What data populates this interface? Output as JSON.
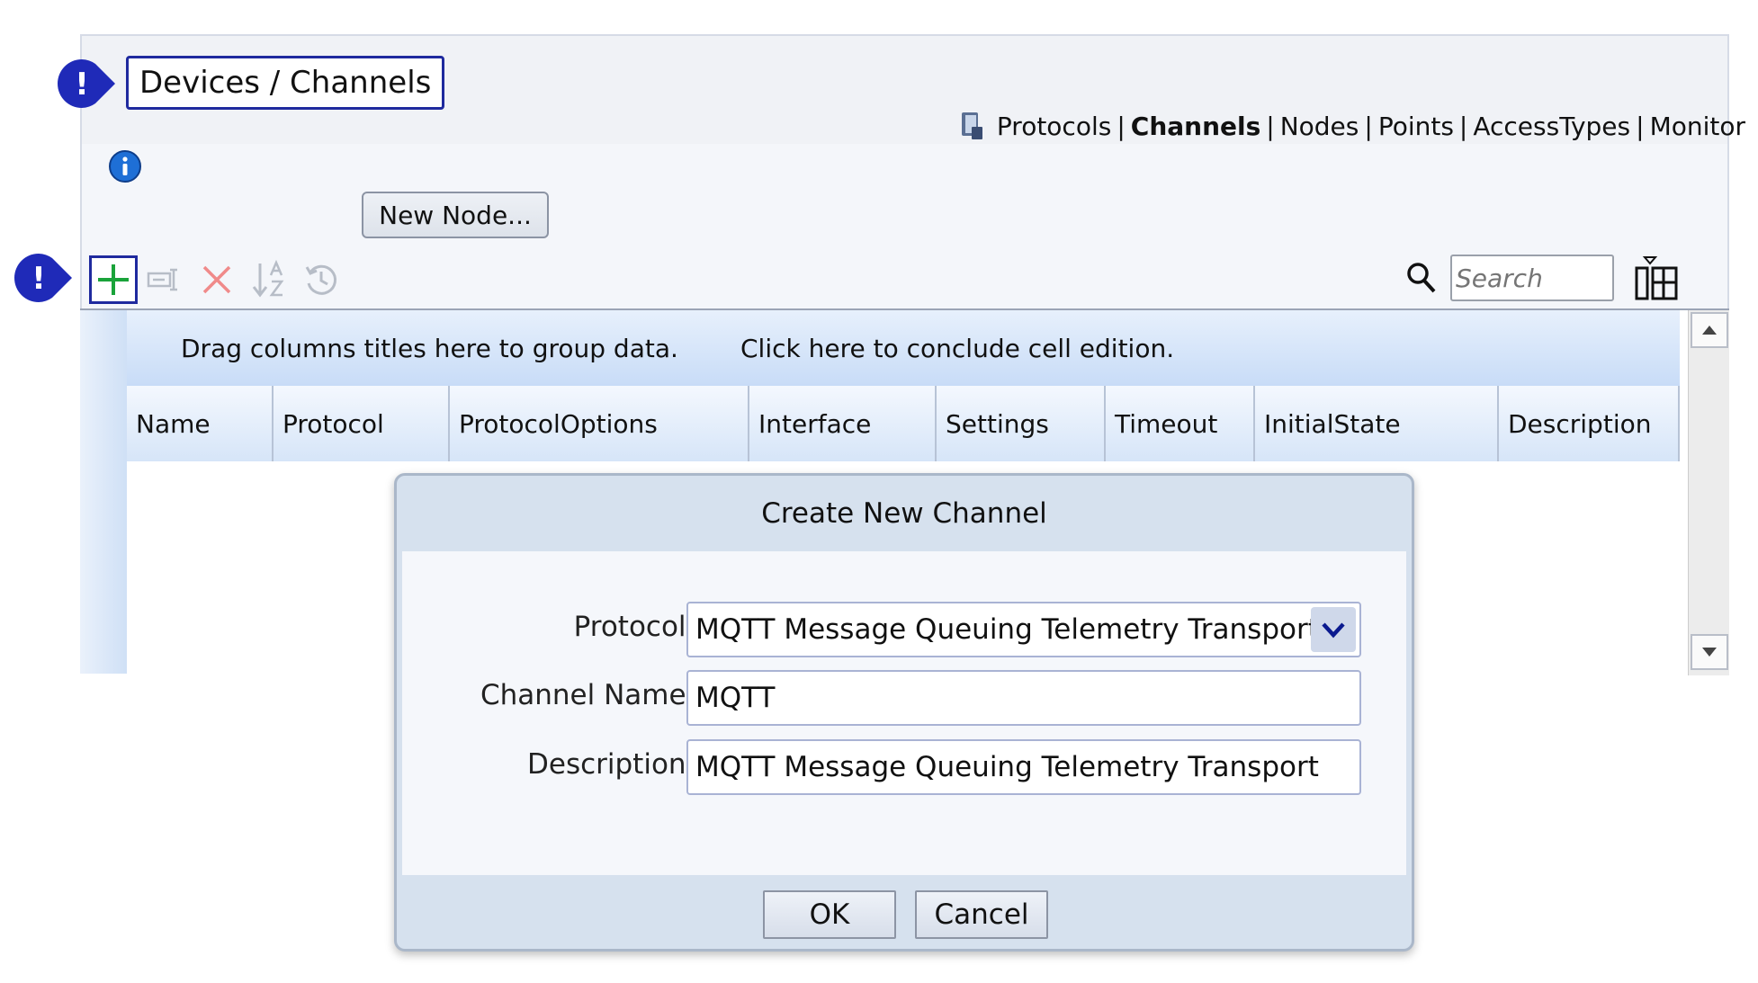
{
  "header": {
    "title": "Devices / Channels"
  },
  "nav": {
    "items": [
      {
        "label": "Protocols",
        "active": false
      },
      {
        "label": "Channels",
        "active": true
      },
      {
        "label": "Nodes",
        "active": false
      },
      {
        "label": "Points",
        "active": false
      },
      {
        "label": "AccessTypes",
        "active": false
      },
      {
        "label": "Monitor",
        "active": false
      }
    ],
    "separator": "|"
  },
  "toolbar": {
    "new_node_label": "New Node...",
    "search_placeholder": "Search"
  },
  "grid": {
    "group_hint": "Drag columns titles here to group data.",
    "edit_hint": "Click here to conclude cell edition.",
    "columns": [
      "Name",
      "Protocol",
      "ProtocolOptions",
      "Interface",
      "Settings",
      "Timeout",
      "InitialState",
      "Description"
    ]
  },
  "dialog": {
    "title": "Create New Channel",
    "protocol_label": "Protocol:",
    "protocol_value": "MQTT Message Queuing Telemetry Transport",
    "channel_name_label": "Channel Name:",
    "channel_name_value": "MQTT",
    "description_label": "Description:",
    "description_value": "MQTT Message Queuing Telemetry Transport",
    "ok_label": "OK",
    "cancel_label": "Cancel"
  },
  "colors": {
    "accent": "#1f2a9e",
    "callout": "#1f2ab8",
    "add_green": "#1aa33a",
    "delete_red": "#f08a8a"
  },
  "callouts": [
    "!",
    "!"
  ]
}
